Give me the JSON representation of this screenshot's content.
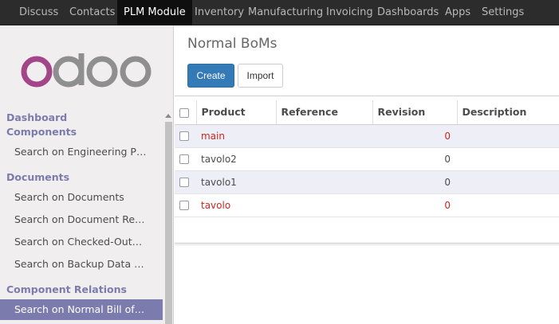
{
  "topnav": {
    "items": [
      {
        "label": "Discuss",
        "active": false
      },
      {
        "label": "Contacts",
        "active": false
      },
      {
        "label": "PLM Module",
        "active": true
      },
      {
        "label": "Inventory",
        "active": false
      },
      {
        "label": "Manufacturing",
        "active": false
      },
      {
        "label": "Invoicing",
        "active": false
      },
      {
        "label": "Dashboards",
        "active": false
      },
      {
        "label": "Apps",
        "active": false
      },
      {
        "label": "Settings",
        "active": false
      }
    ]
  },
  "logo": {
    "text": "odoo",
    "colors": {
      "o1": "#a24689",
      "rest": "#8f8f8f"
    }
  },
  "sidebar": {
    "sections": [
      {
        "heading": "Dashboard Components",
        "items": [
          "Search on Engineering P…"
        ]
      },
      {
        "heading": "Documents",
        "items": [
          "Search on Documents",
          "Search on Document Re…",
          "Search on Checked-Out…",
          "Search on Backup Data …"
        ]
      },
      {
        "heading": "Component Relations",
        "items": [
          "Search on Normal Bill of…"
        ]
      }
    ],
    "active_item": "Search on Normal Bill of…"
  },
  "main": {
    "title": "Normal BoMs",
    "create_label": "Create",
    "import_label": "Import"
  },
  "table": {
    "columns": [
      "Product",
      "Reference",
      "Revision",
      "Description"
    ],
    "rows": [
      {
        "product": "main",
        "reference": "",
        "revision": "0",
        "description": "",
        "highlight": true
      },
      {
        "product": "tavolo2",
        "reference": "",
        "revision": "0",
        "description": "",
        "highlight": false
      },
      {
        "product": "tavolo1",
        "reference": "",
        "revision": "0",
        "description": "",
        "highlight": false
      },
      {
        "product": "tavolo",
        "reference": "",
        "revision": "0",
        "description": "",
        "highlight": true
      }
    ]
  },
  "colors": {
    "accent": "#7c7bad",
    "primary_button": "#337ab7",
    "warning_text": "#c9271f",
    "topbar": "#2c2c2c"
  }
}
